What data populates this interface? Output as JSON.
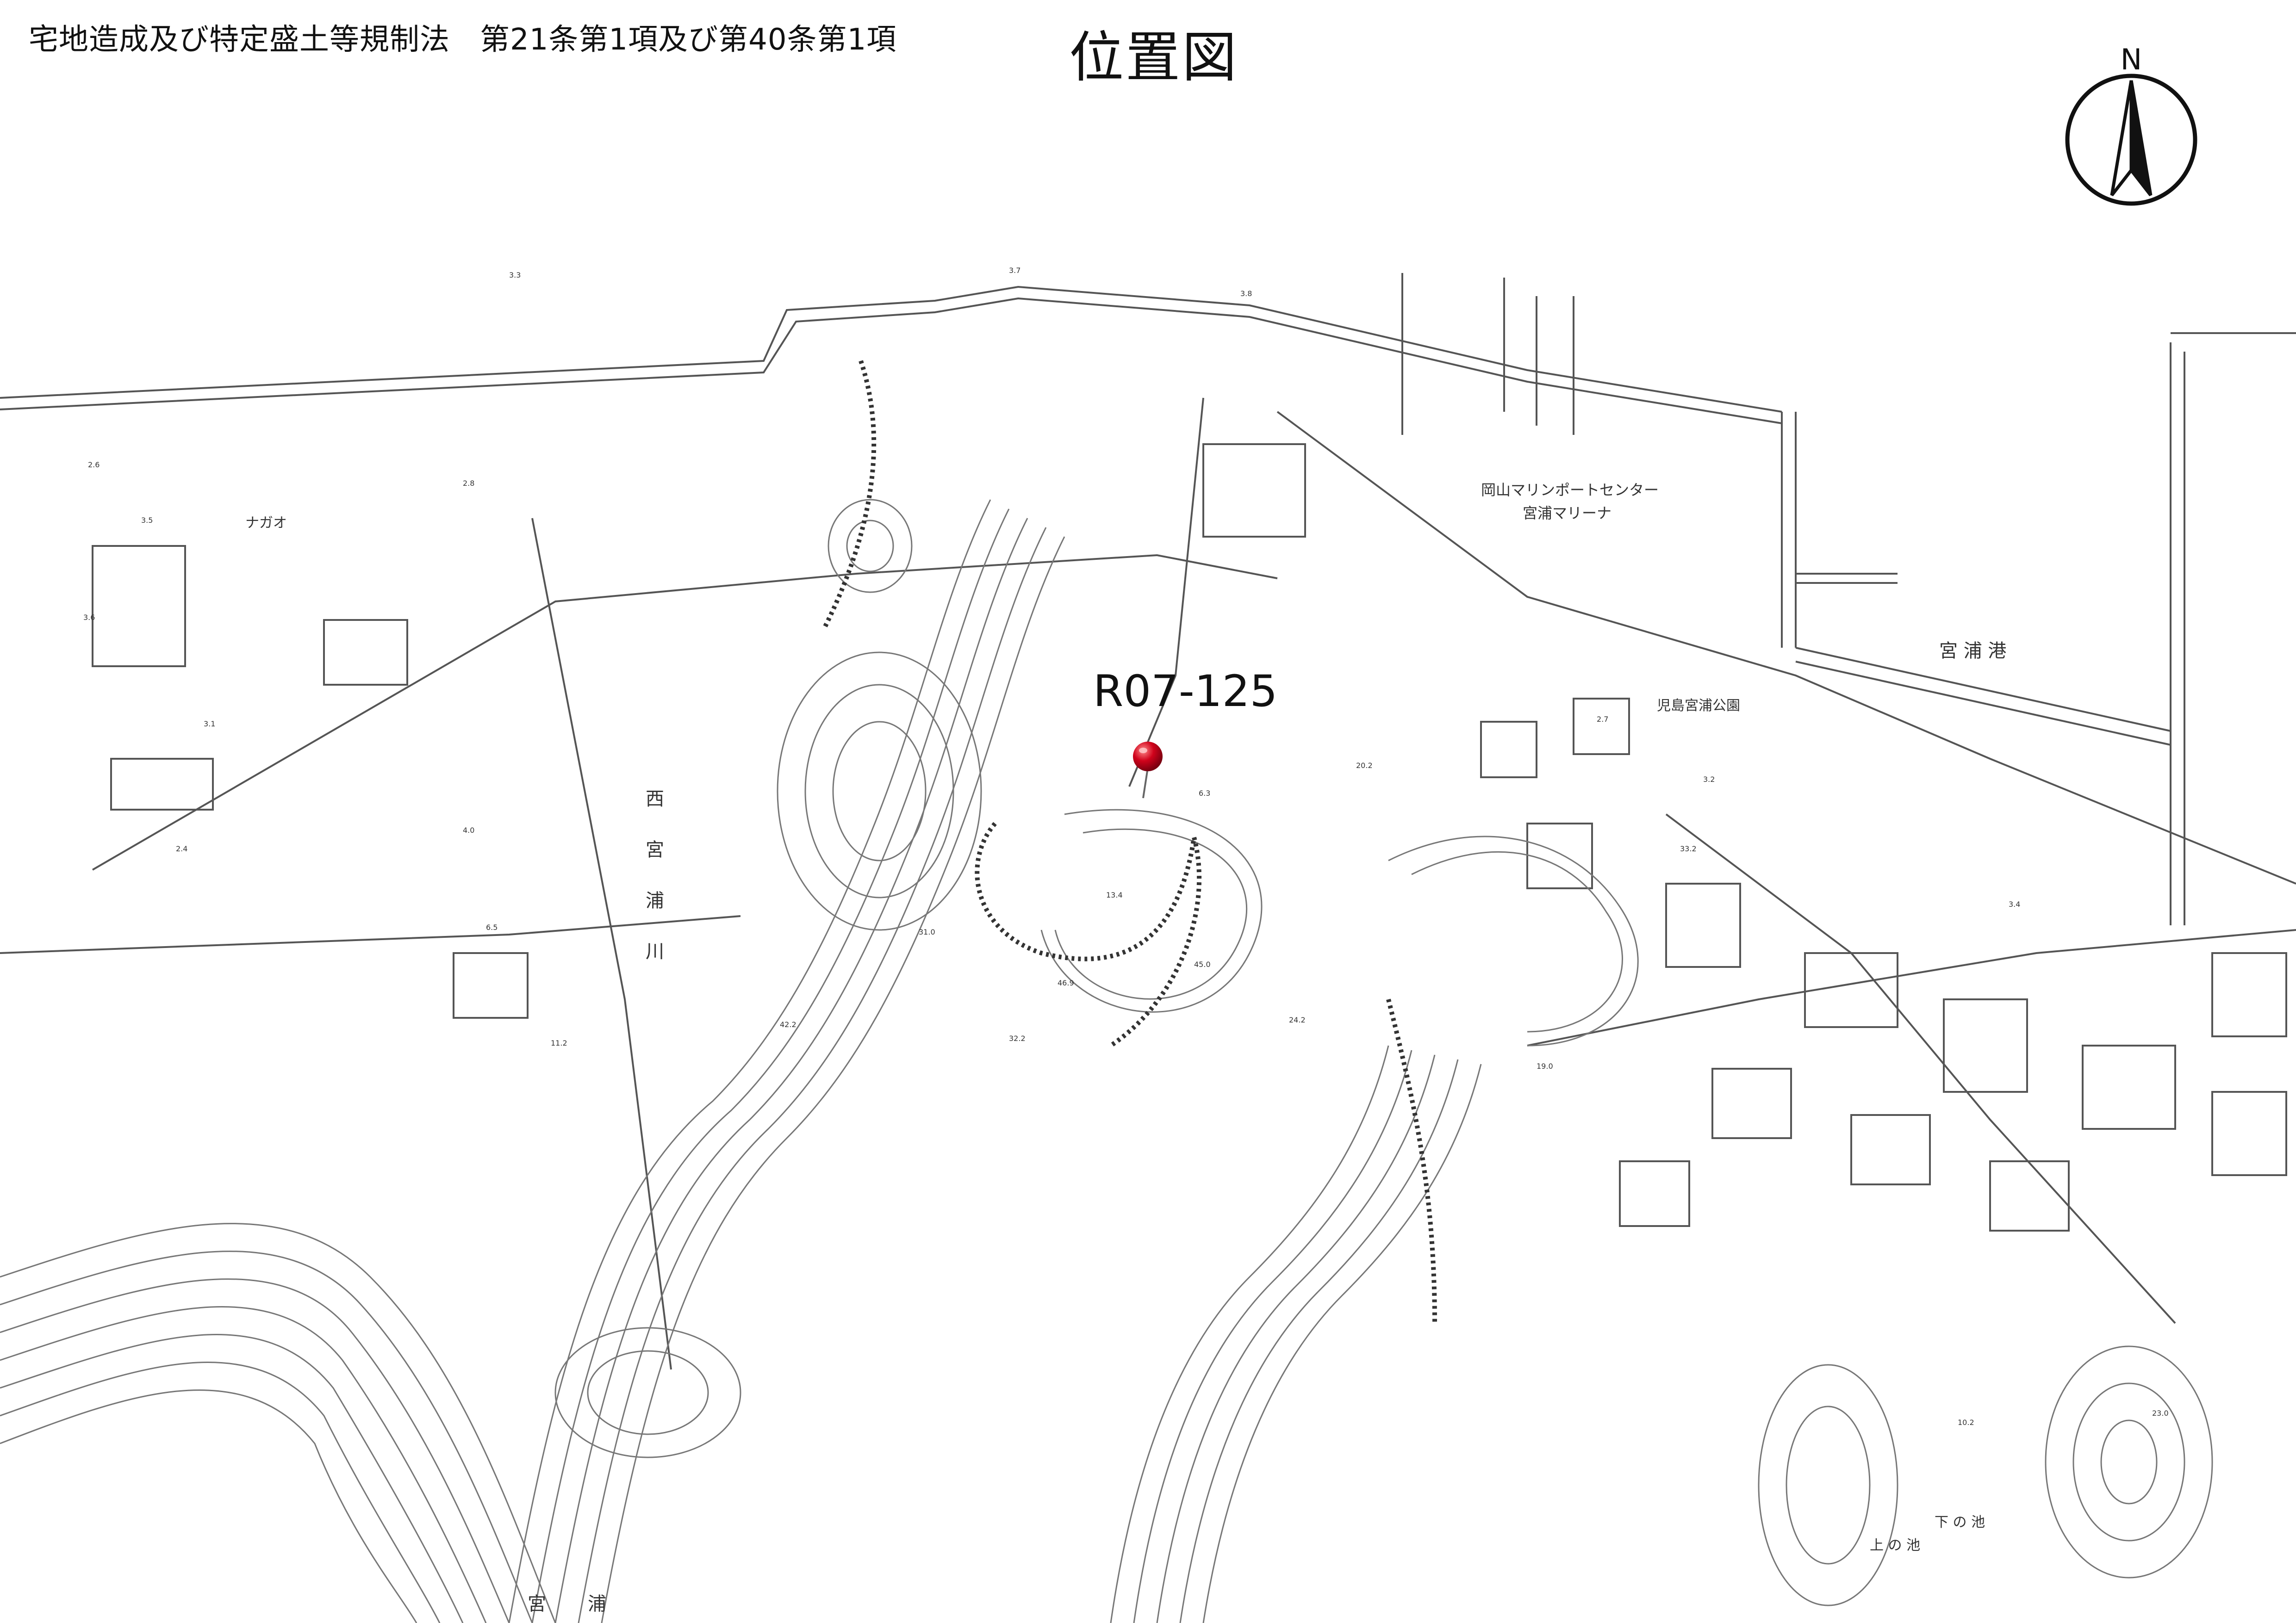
{
  "document": {
    "law_reference": "宅地造成及び特定盛土等規制法　第21条第1項及び第40条第1項",
    "map_title": "位置図"
  },
  "north_arrow": {
    "label": "N",
    "icon": "north-arrow-icon"
  },
  "map": {
    "site": {
      "id": "R07-125",
      "marker_icon": "red-pushpin-icon",
      "marker_color": "#d0021b"
    },
    "place_labels": {
      "marina_center": "岡山マリンポートセンター",
      "marina": "宮浦マリーナ",
      "port": "宮 浦 港",
      "park": "児島宮浦公園",
      "river_1": "西",
      "river_2": "宮",
      "river_3": "浦",
      "river_4": "川",
      "katakana_area": "ナガオ",
      "lower_pond": "下 の 池",
      "upper_pond": "上 の 池",
      "bottom_1": "宮",
      "bottom_2": "浦"
    },
    "spot_heights": [
      "31.0",
      "46.9",
      "42.2",
      "45.0",
      "24.2",
      "32.2",
      "13.4",
      "19.0",
      "33.2",
      "10.2",
      "23.0",
      "3.5",
      "3.1",
      "2.8",
      "2.6",
      "2.4",
      "4.0",
      "6.5",
      "11.2",
      "6.3",
      "20.2",
      "3.2",
      "3.4",
      "3.6",
      "2.7",
      "3.7",
      "3.3",
      "3.8"
    ],
    "line_color": "#555555"
  }
}
